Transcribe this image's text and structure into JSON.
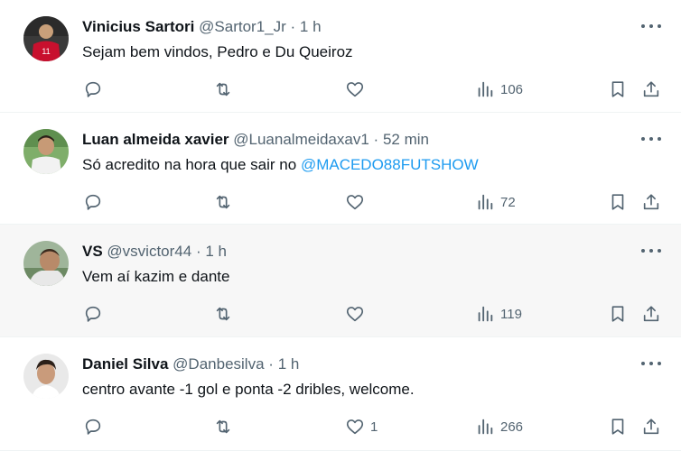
{
  "tweets": [
    {
      "name": "Vinicius Sartori",
      "handle": "@Sartor1_Jr",
      "separator": "·",
      "time": "1 h",
      "text": "Sejam bem vindos, Pedro e Du Queiroz",
      "mention": "",
      "likes": "",
      "views": "106",
      "avatar": "avatar-red-jersey"
    },
    {
      "name": "Luan almeida xavier",
      "handle": "@Luanalmeidaxav1",
      "separator": "·",
      "time": "52 min",
      "text": "Só acredito na hora que sair no ",
      "mention": "@MACEDO88FUTSHOW",
      "likes": "",
      "views": "72",
      "avatar": "avatar-man-green"
    },
    {
      "name": "VS",
      "handle": "@vsvictor44",
      "separator": "·",
      "time": "1 h",
      "text": "Vem aí kazim e dante",
      "mention": "",
      "likes": "",
      "views": "119",
      "avatar": "avatar-boy-outdoor"
    },
    {
      "name": "Daniel Silva",
      "handle": "@Danbesilva",
      "separator": "·",
      "time": "1 h",
      "text": "centro avante -1 gol e ponta -2 dribles, welcome.",
      "mention": "",
      "likes": "1",
      "views": "266",
      "avatar": "avatar-man-white"
    }
  ],
  "colors": {
    "accent": "#1d9bf0",
    "secondary_text": "#536471",
    "hover_background": "#f7f7f7",
    "divider": "#eff3f4"
  },
  "icons": {
    "more": "more-dots-icon",
    "reply": "reply-icon",
    "retweet": "retweet-icon",
    "like": "heart-icon",
    "views": "views-bar-chart-icon",
    "bookmark": "bookmark-icon",
    "share": "share-icon"
  }
}
